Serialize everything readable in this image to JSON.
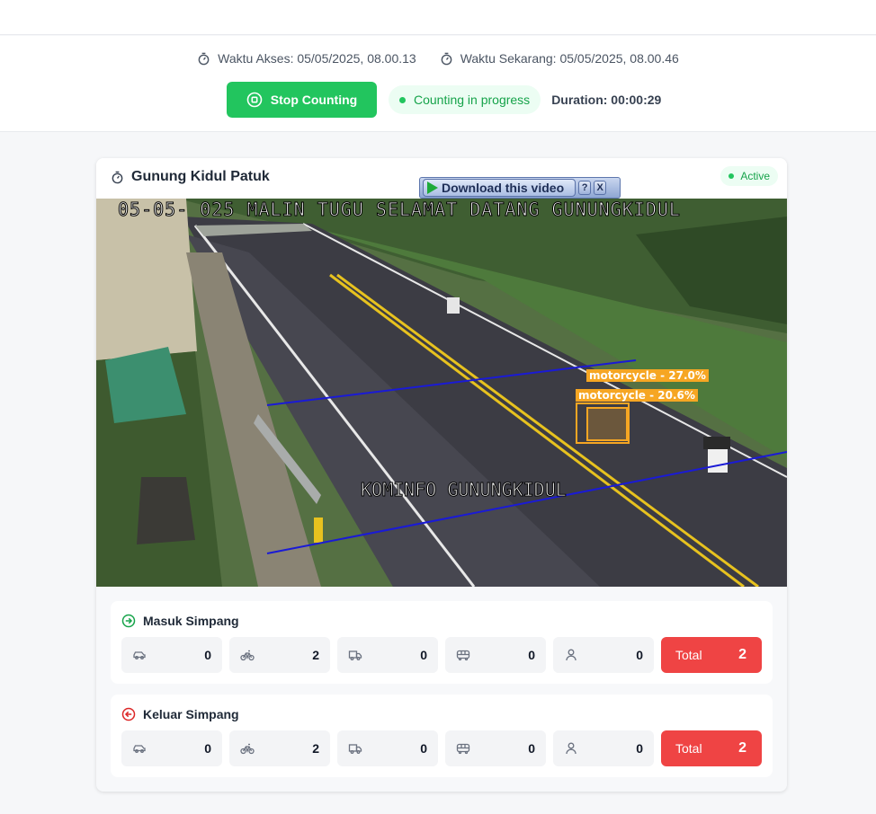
{
  "header": {
    "access_time_label": "Waktu Akses: 05/05/2025, 08.00.13",
    "current_time_label": "Waktu Sekarang: 05/05/2025, 08.00.46",
    "stop_button_label": "Stop Counting",
    "status_text": "Counting in progress",
    "duration_text": "Duration: 00:00:29"
  },
  "camera": {
    "title": "Gunung Kidul Patuk",
    "status": "Active",
    "osd_top": "05-05- 025 MALIN TUGU SELAMAT DATANG GUNUNGKIDUL",
    "osd_bottom": "KOMINFO GUNUNGKIDUL",
    "detections": [
      "motorcycle - 27.0%",
      "motorcycle - 20.6%"
    ],
    "download_label": "Download this video",
    "help_label": "?",
    "close_label": "X"
  },
  "masuk": {
    "title": "Masuk Simpang",
    "counts": [
      {
        "icon": "car-icon",
        "value": "0"
      },
      {
        "icon": "bicycle-icon",
        "value": "2"
      },
      {
        "icon": "truck-icon",
        "value": "0"
      },
      {
        "icon": "bus-icon",
        "value": "0"
      },
      {
        "icon": "person-icon",
        "value": "0"
      }
    ],
    "total_label": "Total",
    "total_value": "2"
  },
  "keluar": {
    "title": "Keluar Simpang",
    "counts": [
      {
        "icon": "car-icon",
        "value": "0"
      },
      {
        "icon": "bicycle-icon",
        "value": "2"
      },
      {
        "icon": "truck-icon",
        "value": "0"
      },
      {
        "icon": "bus-icon",
        "value": "0"
      },
      {
        "icon": "person-icon",
        "value": "0"
      }
    ],
    "total_label": "Total",
    "total_value": "2"
  },
  "colors": {
    "accent_green": "#22c55e",
    "total_red": "#ef4444",
    "detection_orange": "#f6a623",
    "count_line_blue": "#1a1ad6"
  }
}
